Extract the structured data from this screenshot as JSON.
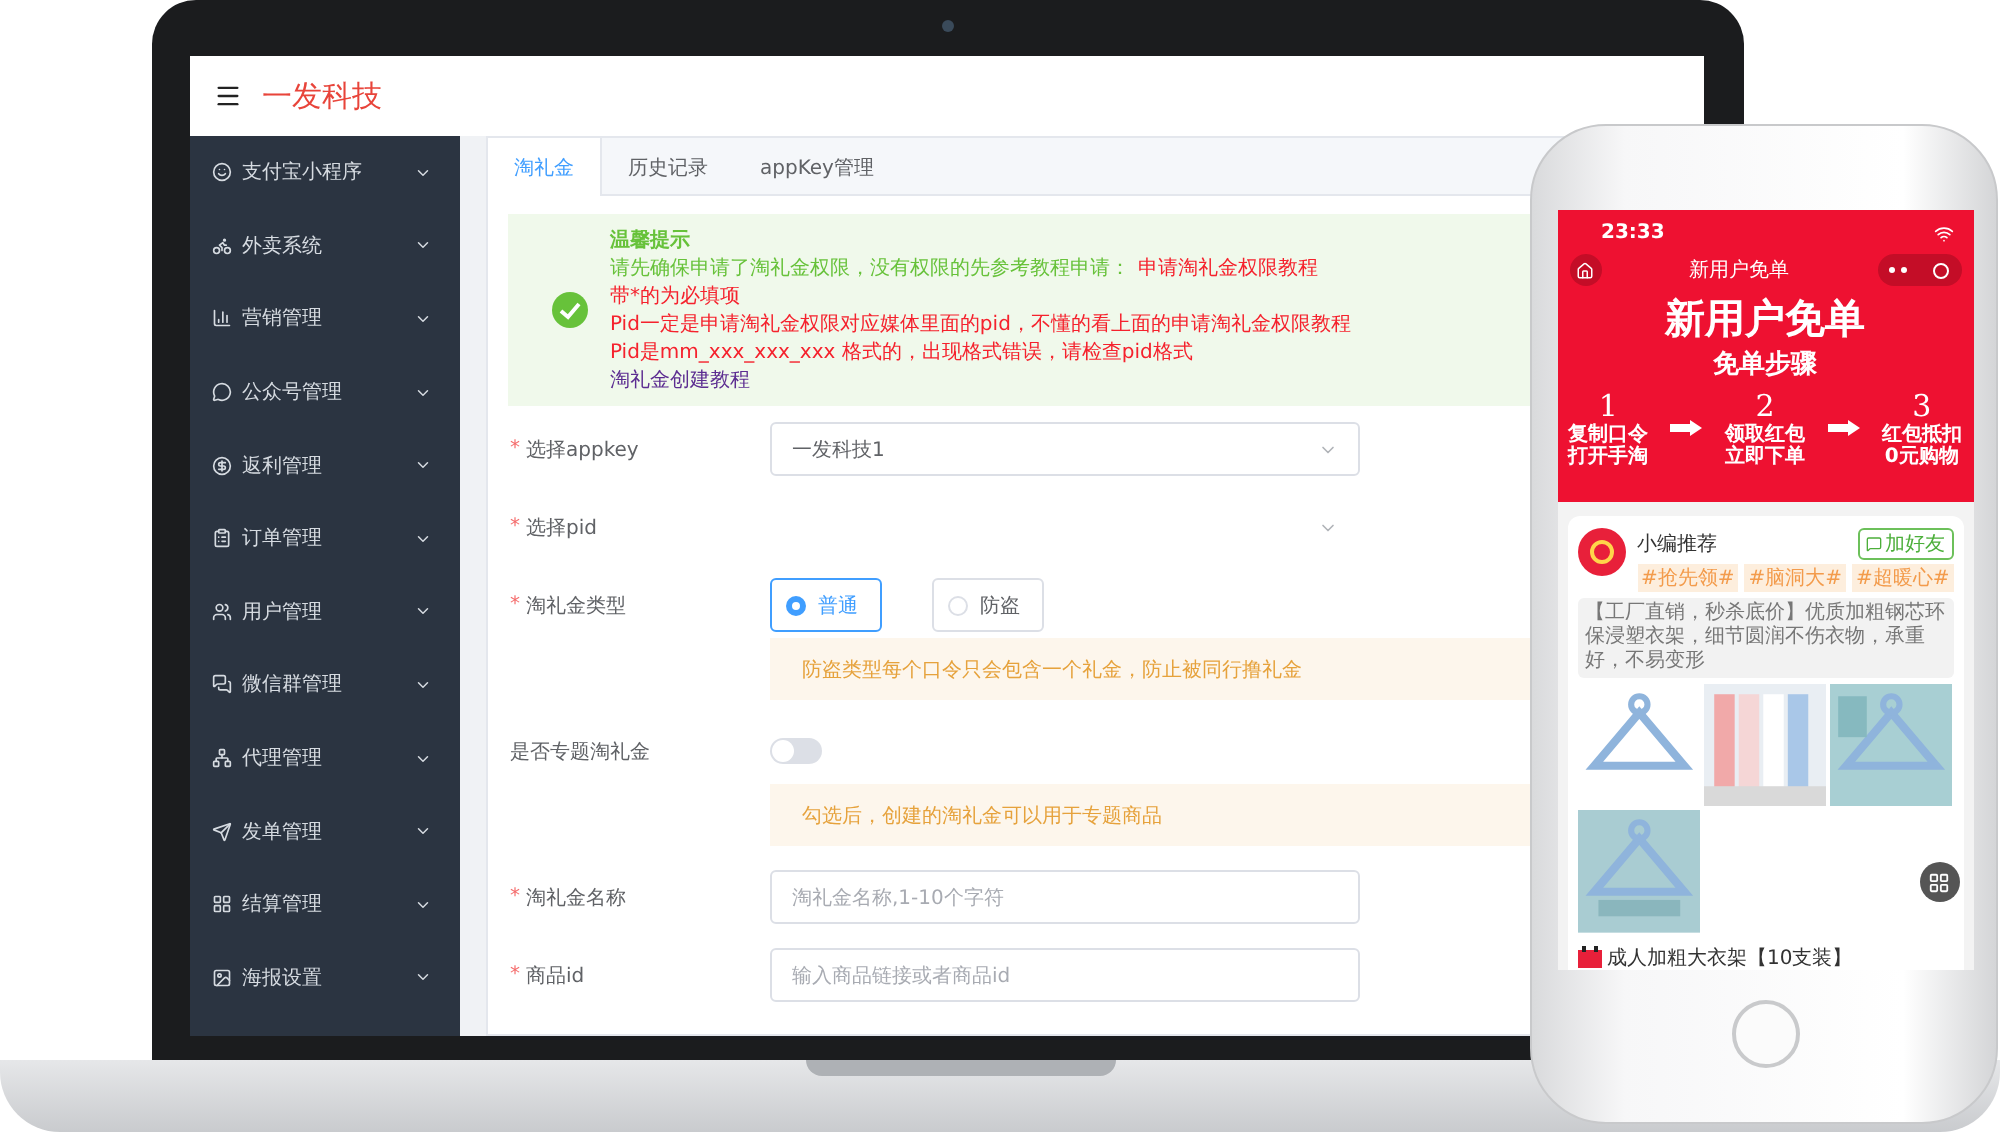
{
  "header": {
    "brand": "一发科技"
  },
  "sidebar": {
    "items": [
      {
        "label": "支付宝小程序"
      },
      {
        "label": "外卖系统"
      },
      {
        "label": "营销管理"
      },
      {
        "label": "公众号管理"
      },
      {
        "label": "返利管理"
      },
      {
        "label": "订单管理"
      },
      {
        "label": "用户管理"
      },
      {
        "label": "微信群管理"
      },
      {
        "label": "代理管理"
      },
      {
        "label": "发单管理"
      },
      {
        "label": "结算管理"
      },
      {
        "label": "海报设置"
      }
    ]
  },
  "tabs": [
    {
      "label": "淘礼金",
      "selected": true
    },
    {
      "label": "历史记录",
      "selected": false
    },
    {
      "label": "appKey管理",
      "selected": false
    }
  ],
  "notice": {
    "title": "温馨提示",
    "lines": [
      {
        "text": "请先确保申请了淘礼金权限，没有权限的先参考教程申请：",
        "link": "申请淘礼金权限教程",
        "color": "#67c23a"
      },
      {
        "text": "带*的为必填项",
        "color": "#f5222d"
      },
      {
        "text": "Pid一定是申请淘礼金权限对应媒体里面的pid，不懂的看上面的申请淘礼金权限教程",
        "color": "#f5222d"
      },
      {
        "text": "Pid是mm_xxx_xxx_xxx 格式的，出现格式错误，请检查pid格式",
        "color": "#f5222d"
      },
      {
        "text": "淘礼金创建教程",
        "color": "#5c2d91"
      }
    ]
  },
  "form": {
    "rows": [
      {
        "kind": "select",
        "asterisk": "*",
        "label": "选择appkey",
        "value": "一发科技1"
      },
      {
        "kind": "select",
        "asterisk": "*",
        "label": "选择pid"
      },
      {
        "kind": "radio",
        "asterisk": "*",
        "label": "淘礼金类型",
        "options": [
          {
            "label": "普通",
            "selected": true
          },
          {
            "label": "防盗",
            "selected": false
          }
        ],
        "tip": "防盗类型每个口令只会包含一个礼金，防止被同行撸礼金"
      },
      {
        "kind": "switch",
        "label": "是否专题淘礼金",
        "on": false,
        "tip": "勾选后，创建的淘礼金可以用于专题商品"
      },
      {
        "kind": "input",
        "asterisk": "*",
        "label": "淘礼金名称",
        "placeholder": "淘礼金名称,1-10个字符"
      },
      {
        "kind": "input",
        "asterisk": "*",
        "label": "商品id",
        "placeholder": "输入商品链接或者商品id"
      }
    ]
  },
  "phone": {
    "status_time": "23:33",
    "nav_title": "新用户免单",
    "banner_title": "新用户免单",
    "banner_subtitle": "免单步骤",
    "steps": [
      {
        "number": "1",
        "lines": [
          "复制口令",
          "打开手淘"
        ]
      },
      {
        "number": "2",
        "lines": [
          "领取红包",
          "立即下单"
        ]
      },
      {
        "number": "3",
        "lines": [
          "红包抵扣",
          "0元购物"
        ]
      }
    ],
    "post": {
      "author": "小编推荐",
      "tags": [
        "#抢先领#",
        "#脑洞大#",
        "#超暖心#"
      ],
      "add_friend": "加好友",
      "description": "【工厂直销，秒杀底价】优质加粗钢芯环保浸塑衣架，细节圆润不伤衣物，承重好，不易变形",
      "images": [
        {
          "kind": "picture"
        },
        {
          "kind": "picture"
        },
        {
          "kind": "picture"
        },
        {
          "kind": "picture"
        }
      ],
      "product_title": "成人加粗大衣架【10支装】"
    }
  }
}
